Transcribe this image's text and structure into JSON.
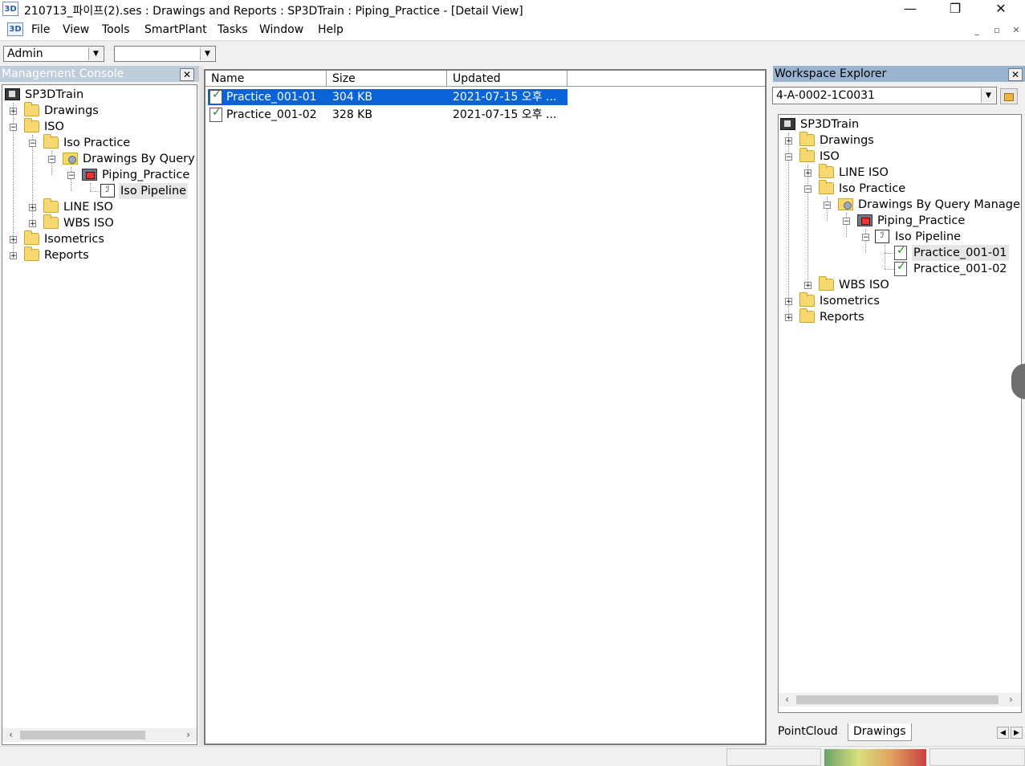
{
  "window": {
    "icon_text": "3D",
    "title": "210713_파이프(2).ses : Drawings and Reports : SP3DTrain : Piping_Practice - [Detail View]",
    "minimize": "—",
    "restore": "❐",
    "close": "✕"
  },
  "menu": {
    "items": [
      "File",
      "View",
      "Tools",
      "SmartPlant",
      "Tasks",
      "Window",
      "Help"
    ],
    "mdi_minimize": "_",
    "mdi_restore": "▫",
    "mdi_close": "✕"
  },
  "toolbar": {
    "combo1_value": "Admin",
    "combo2_value": ""
  },
  "management_console": {
    "title": "Management Console",
    "close_label": "✕",
    "tree": [
      {
        "label": "SP3DTrain",
        "icon": "plant-root-icon"
      },
      {
        "label": "Drawings",
        "icon": "folder-icon",
        "expander": "+"
      },
      {
        "label": "ISO",
        "icon": "folder-icon",
        "expander": "−"
      },
      {
        "label": "Iso Practice",
        "icon": "folder-icon",
        "expander": "−"
      },
      {
        "label": "Drawings By Query",
        "icon": "query-folder-icon",
        "expander": "−"
      },
      {
        "label": "Piping_Practice",
        "icon": "filter-icon",
        "expander": "−"
      },
      {
        "label": "Iso Pipeline",
        "icon": "isometric-icon",
        "selected": true
      },
      {
        "label": "LINE ISO",
        "icon": "folder-icon",
        "expander": "+"
      },
      {
        "label": "WBS ISO",
        "icon": "folder-icon",
        "expander": "+"
      },
      {
        "label": "Isometrics",
        "icon": "folder-icon",
        "expander": "+"
      },
      {
        "label": "Reports",
        "icon": "folder-icon",
        "expander": "+"
      }
    ]
  },
  "detail_view": {
    "columns": [
      "Name",
      "Size",
      "Updated"
    ],
    "rows": [
      {
        "name": "Practice_001-01",
        "size": "304 KB",
        "updated": "2021-07-15 오후 ...",
        "selected": true
      },
      {
        "name": "Practice_001-02",
        "size": "328 KB",
        "updated": "2021-07-15 오후 ...",
        "selected": false
      }
    ]
  },
  "workspace_explorer": {
    "title": "Workspace Explorer",
    "close_label": "✕",
    "filter_value": "4-A-0002-1C0031",
    "tree": [
      {
        "label": "SP3DTrain",
        "icon": "plant-root-icon"
      },
      {
        "label": "Drawings",
        "icon": "folder-icon",
        "expander": "+"
      },
      {
        "label": "ISO",
        "icon": "folder-icon",
        "expander": "−"
      },
      {
        "label": "LINE ISO",
        "icon": "folder-icon",
        "expander": "+"
      },
      {
        "label": "Iso Practice",
        "icon": "folder-icon",
        "expander": "−"
      },
      {
        "label": "Drawings By Query Manage",
        "icon": "query-folder-icon",
        "expander": "−"
      },
      {
        "label": "Piping_Practice",
        "icon": "filter-icon",
        "expander": "−"
      },
      {
        "label": "Iso Pipeline",
        "icon": "isometric-icon",
        "expander": "−"
      },
      {
        "label": "Practice_001-01",
        "icon": "drawing-checked-icon",
        "selected": true
      },
      {
        "label": "Practice_001-02",
        "icon": "drawing-checked-icon"
      },
      {
        "label": "WBS ISO",
        "icon": "folder-icon",
        "expander": "+"
      },
      {
        "label": "Isometrics",
        "icon": "folder-icon",
        "expander": "+"
      },
      {
        "label": "Reports",
        "icon": "folder-icon",
        "expander": "+"
      }
    ],
    "tabs": [
      "PointCloud",
      "Drawings"
    ],
    "active_tab": "Drawings"
  },
  "colors": {
    "selection": "#0a64d8",
    "panel_header_active": "#99b4d1",
    "panel_header_inactive": "#bfcddb",
    "folder": "#f8d870"
  }
}
